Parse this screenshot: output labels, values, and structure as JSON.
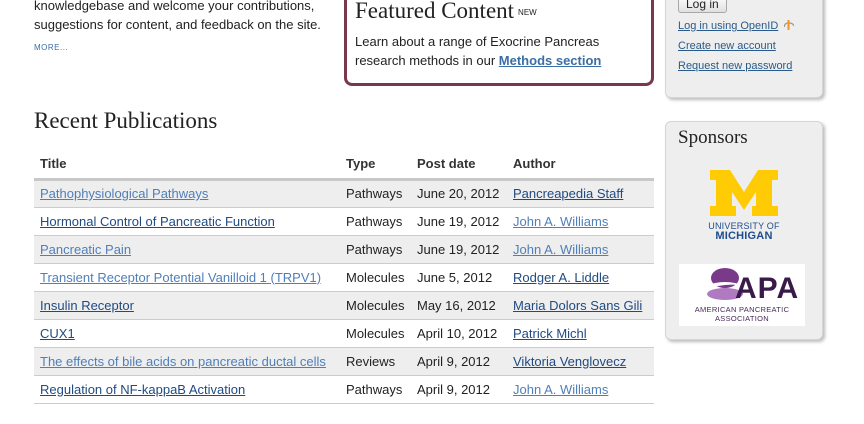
{
  "intro": {
    "line1": "knowledgebase and welcome your contributions,",
    "line2": "suggestions for content, and feedback on the site.",
    "more": "MORE..."
  },
  "featured": {
    "title": "Featured Content",
    "badge": "NEW",
    "text": "Learn about a range of Exocrine Pancreas research methods in our ",
    "link": "Methods section"
  },
  "login": {
    "button": "Log in",
    "links": [
      "Log in using OpenID",
      "Create new account",
      "Request new password"
    ]
  },
  "sponsors": {
    "title": "Sponsors",
    "michigan": {
      "line1": "UNIVERSITY OF",
      "line2": "MICHIGAN",
      "color": "#ffcb05"
    },
    "apa": {
      "letters": "APA",
      "line1": "AMERICAN PANCREATIC",
      "line2": "ASSOCIATION"
    }
  },
  "publications": {
    "title": "Recent Publications",
    "columns": [
      "Title",
      "Type",
      "Post date",
      "Author"
    ],
    "rows": [
      {
        "title": "Pathophysiological Pathways",
        "type": "Pathways",
        "date": "June 20, 2012",
        "author": "Pancreapedia Staff"
      },
      {
        "title": "Hormonal Control of Pancreatic Function",
        "type": "Pathways",
        "date": "June 19, 2012",
        "author": "John A. Williams"
      },
      {
        "title": "Pancreatic Pain",
        "type": "Pathways",
        "date": "June 19, 2012",
        "author": "John A. Williams"
      },
      {
        "title": "Transient Receptor Potential Vanilloid 1 (TRPV1)",
        "type": "Molecules",
        "date": "June 5, 2012",
        "author": "Rodger A. Liddle"
      },
      {
        "title": "Insulin Receptor",
        "type": "Molecules",
        "date": "May 16, 2012",
        "author": "Maria Dolors Sans Gili"
      },
      {
        "title": "CUX1",
        "type": "Molecules",
        "date": "April 10, 2012",
        "author": "Patrick Michl"
      },
      {
        "title": "The effects of bile acids on pancreatic ductal cells",
        "type": "Reviews",
        "date": "April 9, 2012",
        "author": "Viktoria Venglovecz"
      },
      {
        "title": "Regulation of NF-kappaB Activation",
        "type": "Pathways",
        "date": "April 9, 2012",
        "author": "John A. Williams"
      }
    ]
  }
}
